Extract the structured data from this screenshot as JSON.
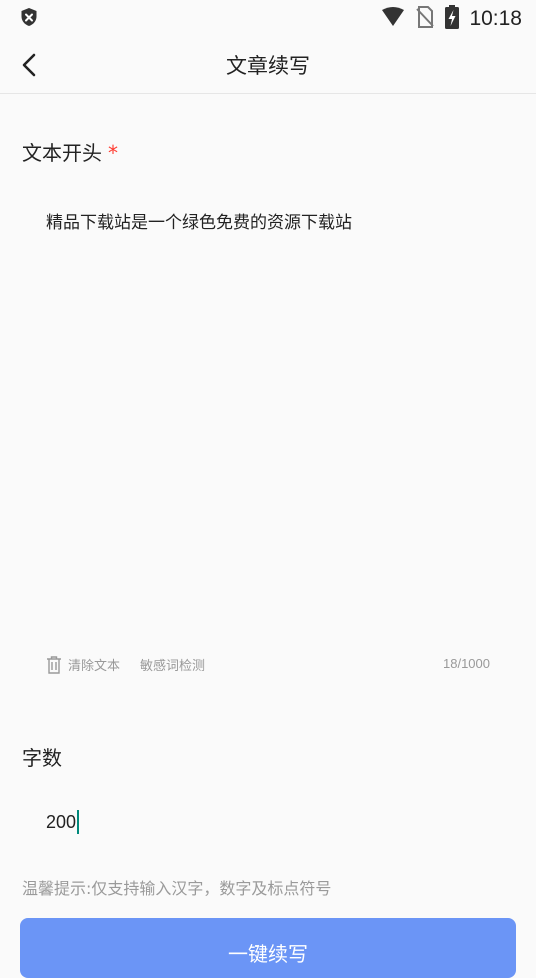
{
  "status_bar": {
    "time": "10:18",
    "icons": [
      "shield-x-icon",
      "wifi-icon",
      "no-sim-icon",
      "battery-charging-icon"
    ]
  },
  "header": {
    "title": "文章续写",
    "back_icon": "chevron-left-icon"
  },
  "text_section": {
    "label": "文本开头",
    "required_mark": "*",
    "value": "精品下载站是一个绿色免费的资源下载站",
    "clear_label": "清除文本",
    "sensitive_label": "敏感词检测",
    "counter": "18/1000"
  },
  "word_count": {
    "label": "字数",
    "value": "200"
  },
  "tip": "温馨提示:仅支持输入汉字，数字及标点符号",
  "submit_label": "一键续写",
  "colors": {
    "accent": "#6b95f6",
    "required": "#ff3b30",
    "caret": "#00897b"
  }
}
